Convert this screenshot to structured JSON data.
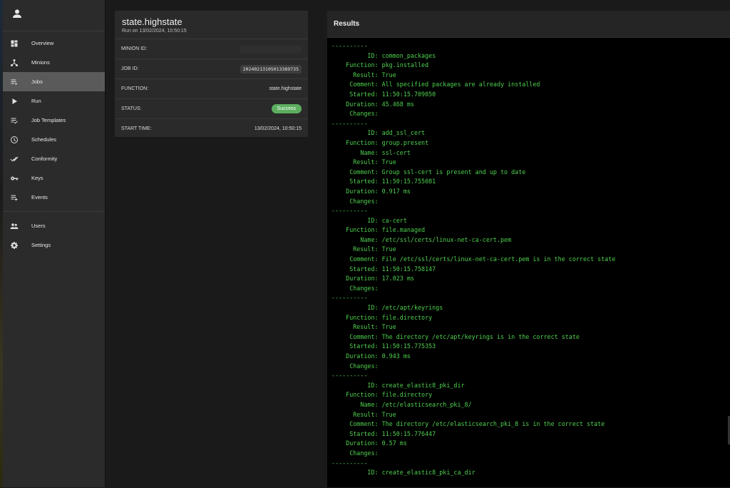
{
  "sidebar": {
    "user_icon": "account-icon",
    "items": [
      {
        "label": "Overview",
        "icon": "dashboard-icon"
      },
      {
        "label": "Minions",
        "icon": "hub-icon"
      },
      {
        "label": "Jobs",
        "icon": "list-icon",
        "active": true
      },
      {
        "label": "Run",
        "icon": "play-icon"
      },
      {
        "label": "Job Templates",
        "icon": "checklist-icon"
      },
      {
        "label": "Schedules",
        "icon": "clock-icon"
      },
      {
        "label": "Conformity",
        "icon": "double-check-icon"
      },
      {
        "label": "Keys",
        "icon": "key-icon"
      },
      {
        "label": "Events",
        "icon": "playlist-add-icon"
      }
    ],
    "secondary": [
      {
        "label": "Users",
        "icon": "people-icon"
      },
      {
        "label": "Settings",
        "icon": "gear-icon"
      }
    ]
  },
  "job": {
    "title": "state.highstate",
    "subtitle": "Run on 13/02/2024, 10:50:15",
    "minion_id_label": "MINION ID:",
    "minion_id_value": "",
    "job_id_label": "JOB ID:",
    "job_id_value": "20240213105013389735",
    "function_label": "FUNCTION:",
    "function_value": "state.highstate",
    "status_label": "STATUS:",
    "status_value": "Success",
    "start_time_label": "START TIME:",
    "start_time_value": "13/02/2024, 10:50:15"
  },
  "results": {
    "title": "Results",
    "text": "----------\n          ID: common_packages\n    Function: pkg.installed\n      Result: True\n     Comment: All specified packages are already installed\n     Started: 11:50:15.709050\n    Duration: 45.468 ms\n     Changes:\n----------\n          ID: add_ssl_cert\n    Function: group.present\n        Name: ssl-cert\n      Result: True\n     Comment: Group ssl-cert is present and up to date\n     Started: 11:50:15.755081\n    Duration: 0.917 ms\n     Changes:\n----------\n          ID: ca-cert\n    Function: file.managed\n        Name: /etc/ssl/certs/linux-net-ca-cert.pem\n      Result: True\n     Comment: File /etc/ssl/certs/linux-net-ca-cert.pem is in the correct state\n     Started: 11:50:15.758147\n    Duration: 17.023 ms\n     Changes:\n----------\n          ID: /etc/apt/keyrings\n    Function: file.directory\n      Result: True\n     Comment: The directory /etc/apt/keyrings is in the correct state\n     Started: 11:50:15.775353\n    Duration: 0.943 ms\n     Changes:\n----------\n          ID: create_elastic8_pki_dir\n    Function: file.directory\n        Name: /etc/elasticsearch_pki_8/\n      Result: True\n     Comment: The directory /etc/elasticsearch_pki_8 is in the correct state\n     Started: 11:50:15.776447\n    Duration: 0.57 ms\n     Changes:\n----------\n          ID: create_elastic8_pki_ca_dir"
  },
  "colors": {
    "success": "#5cae5f",
    "log_text": "#4fd04f",
    "active_nav": "#5a5a5a"
  }
}
